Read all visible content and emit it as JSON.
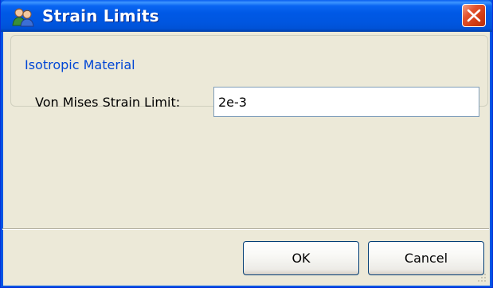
{
  "window": {
    "title": "Strain Limits",
    "app_icon": "users-icon",
    "close_icon": "close-icon"
  },
  "group": {
    "legend": "Isotropic Material"
  },
  "fields": {
    "von_mises_label": "Von Mises Strain Limit:",
    "von_mises_value": "2e-3"
  },
  "buttons": {
    "ok_label": "OK",
    "cancel_label": "Cancel"
  },
  "colors": {
    "titlebar": "#0054E3",
    "dialog_background": "#ECE9D8",
    "legend_text": "#0046D5",
    "close_button": "#D03A12"
  }
}
